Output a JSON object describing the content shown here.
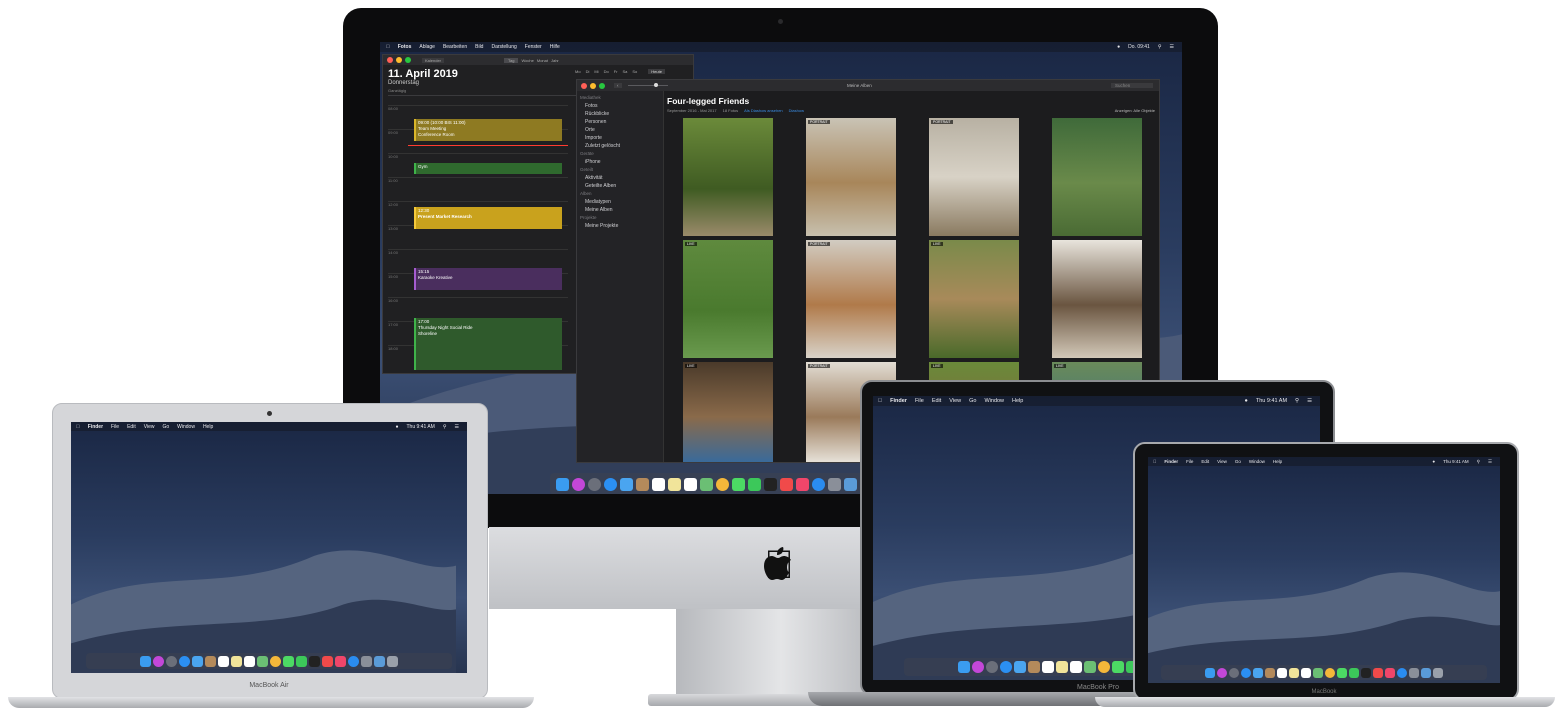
{
  "colors": {
    "wallpaper_top": "#1a2744",
    "wallpaper_bottom": "#3b4f74",
    "dune": "#55647f",
    "calendar_yellow": "#8e7a22",
    "calendar_yellow_bright": "#c9a21d",
    "calendar_green": "#2f6a2e",
    "calendar_green_bright": "#3fb34a",
    "calendar_purple": "#4a2e5e",
    "photos_bg": "#1c1c1e",
    "link_blue": "#3a8ee6"
  },
  "imac": {
    "menubar": {
      "apple_icon": "apple-icon",
      "items": [
        "Fotos",
        "Ablage",
        "Bearbeiten",
        "Bild",
        "Darstellung",
        "Fenster",
        "Hilfe"
      ],
      "clock": "Do. 09:41"
    },
    "calendar": {
      "toolbar": [
        "Kalender",
        "Tag",
        "Woche",
        "Monat",
        "Jahr"
      ],
      "date": "11. April 2019",
      "weekday": "Donnerstag",
      "all_day": "Ganztägig",
      "events": [
        {
          "time": "09:00 (10:00 BIS 11:00)",
          "title": "Team Meeting",
          "sub": "Conference Room",
          "color": "yellow"
        },
        {
          "time": "",
          "title": "Gym",
          "sub": "",
          "color": "green"
        },
        {
          "time": "12:30",
          "title": "Present Market Research",
          "sub": "",
          "color": "yellow_bright"
        },
        {
          "time": "15:15",
          "title": "Karaoke Kreative",
          "sub": "",
          "color": "purple"
        },
        {
          "time": "17:00",
          "title": "Thursday Night Social Ride",
          "sub": "Shoreline",
          "color": "green_bright"
        }
      ],
      "now": "10:06",
      "hours": [
        "08:00",
        "09:00",
        "10:00",
        "11:00",
        "12:00",
        "13:00",
        "14:00",
        "15:00",
        "16:00",
        "17:00",
        "18:00"
      ],
      "mini_days": [
        "Mo",
        "Di",
        "Mi",
        "Do",
        "Fr",
        "Sa",
        "So"
      ],
      "today_button": "Heute"
    },
    "photos": {
      "window_title": "Meine Alben",
      "search_placeholder": "Suchen",
      "title": "Four-legged Friends",
      "date_range": "September 2016 - Mai 2017",
      "count": "18 Fotos",
      "slideshow_link": "Als Diashow ansehen",
      "more_link": "Diashow",
      "sort": "Anzeigen: Alle Objekte",
      "sidebar": [
        {
          "header": "Mediathek",
          "items": [
            "Fotos",
            "Rückblicke",
            "Personen",
            "Orte",
            "Importe",
            "Zuletzt gelöscht"
          ]
        },
        {
          "header": "Geräte",
          "items": [
            "iPhone"
          ]
        },
        {
          "header": "Geteilt",
          "items": [
            "Aktivität",
            "Geteilte Alben"
          ]
        },
        {
          "header": "Alben",
          "items": [
            "Mediatypen",
            "Meine Alben"
          ]
        },
        {
          "header": "Projekte",
          "items": [
            "Meine Projekte"
          ]
        }
      ],
      "photo_tags": [
        "",
        "PORTRAIT",
        "PORTRAIT",
        "",
        "LIVE",
        "PORTRAIT",
        "LIVE",
        "",
        "LIVE",
        "PORTRAIT",
        "LIVE",
        "LIVE"
      ]
    }
  },
  "macbook_air": {
    "menubar": {
      "items": [
        "Finder",
        "File",
        "Edit",
        "View",
        "Go",
        "Window",
        "Help"
      ],
      "clock": "Thu 9:41 AM"
    },
    "label": "MacBook Air"
  },
  "macbook_pro": {
    "menubar": {
      "items": [
        "Finder",
        "File",
        "Edit",
        "View",
        "Go",
        "Window",
        "Help"
      ],
      "clock": "Thu 9:41 AM"
    },
    "label": "MacBook Pro"
  },
  "macbook": {
    "menubar": {
      "items": [
        "Finder",
        "File",
        "Edit",
        "View",
        "Go",
        "Window",
        "Help"
      ],
      "clock": "Thu 9:41 AM"
    },
    "label": "MacBook"
  },
  "dock_icons": [
    "finder-icon",
    "siri-icon",
    "launchpad-icon",
    "safari-icon",
    "mail-icon",
    "contacts-icon",
    "calendar-icon",
    "notes-icon",
    "reminders-icon",
    "maps-icon",
    "photos-icon",
    "messages-icon",
    "facetime-icon",
    "stocks-icon",
    "news-icon",
    "music-icon",
    "appstore-icon",
    "preferences-icon",
    "downloads-icon",
    "trash-icon"
  ],
  "dock_colors": [
    "#3a9cf0",
    "#c347d8",
    "#6b6f7a",
    "#2b8ff2",
    "#4aa5f0",
    "#b48a5b",
    "#ffffff",
    "#f1e49a",
    "#ffffff",
    "#6bbf74",
    "#f4b73a",
    "#4cd964",
    "#3cc85a",
    "#222222",
    "#f04a4a",
    "#f0466a",
    "#2a8cf0",
    "#8a8f99",
    "#5a9bd8",
    "#9aa0aa"
  ]
}
